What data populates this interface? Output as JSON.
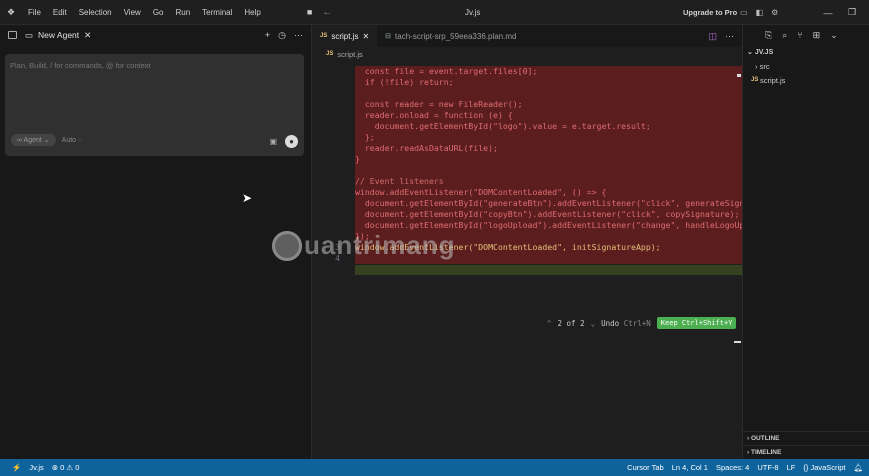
{
  "titlebar": {
    "menus": [
      "File",
      "Edit",
      "Selection",
      "View",
      "Go",
      "Run",
      "Terminal",
      "Help"
    ],
    "title": "Jv.js",
    "upgrade": "Upgrade to Pro"
  },
  "chat": {
    "tab_label": "New Agent",
    "placeholder": "Plan, Build, / for commands, @ for context",
    "agent_mode": "∞ Agent ⌄",
    "model": "Auto ◌"
  },
  "editor": {
    "tabs": [
      {
        "label": "script.js",
        "icon": "JS"
      },
      {
        "label": "tach-script-srp_59eea336.plan.md",
        "icon": "md"
      }
    ],
    "breadcrumb": "script.js",
    "lines": [
      {
        "num": "",
        "text": "  const file = event.target.files[0];",
        "kind": "removed"
      },
      {
        "num": "",
        "text": "  if (!file) return;",
        "kind": "removed"
      },
      {
        "num": "",
        "text": "",
        "kind": "removed"
      },
      {
        "num": "",
        "text": "  const reader = new FileReader();",
        "kind": "removed"
      },
      {
        "num": "",
        "text": "  reader.onload = function (e) {",
        "kind": "removed"
      },
      {
        "num": "",
        "text": "    document.getElementById(\"logo\").value = e.target.result;",
        "kind": "removed"
      },
      {
        "num": "",
        "text": "  };",
        "kind": "removed"
      },
      {
        "num": "",
        "text": "  reader.readAsDataURL(file);",
        "kind": "removed"
      },
      {
        "num": "",
        "text": "}",
        "kind": "removed"
      },
      {
        "num": "",
        "text": "",
        "kind": "removed"
      },
      {
        "num": "",
        "text": "// Event listeners",
        "kind": "removed"
      },
      {
        "num": "",
        "text": "window.addEventListener(\"DOMContentLoaded\", () => {",
        "kind": "removed"
      },
      {
        "num": "",
        "text": "  document.getElementById(\"generateBtn\").addEventListener(\"click\", generateSign",
        "kind": "removed"
      },
      {
        "num": "",
        "text": "  document.getElementById(\"copyBtn\").addEventListener(\"click\", copySignature);",
        "kind": "removed"
      },
      {
        "num": "",
        "text": "  document.getElementById(\"logoUpload\").addEventListener(\"change\", handleLogoUp",
        "kind": "removed"
      },
      {
        "num": "",
        "text": "});",
        "kind": "removed"
      },
      {
        "num": "3",
        "text": "window.addEventListener(\"DOMContentLoaded\", initSignatureApp);",
        "kind": "added"
      },
      {
        "num": "4",
        "text": "",
        "kind": "normal"
      }
    ],
    "diff_nav": "2 of 2",
    "undo_label": "Undo",
    "undo_shortcut": "Ctrl+N",
    "keep_label": "Keep",
    "keep_shortcut": "Ctrl+Shift+Y"
  },
  "explorer": {
    "root": "JV.JS",
    "folder": "src",
    "file": "script.js",
    "outline": "OUTLINE",
    "timeline": "TIMELINE"
  },
  "watermark": "uantrimang",
  "statusbar": {
    "file": "Jv.js",
    "problems": "⊗ 0 ⚠ 0",
    "cursor_tab": "Cursor Tab",
    "position": "Ln 4, Col 1",
    "spaces": "Spaces: 4",
    "encoding": "UTF-8",
    "eol": "LF",
    "language": "{} JavaScript"
  },
  "colors": {
    "statusbar_bg": "#0e639c",
    "removed_bg": "#5b1d1d",
    "added_bg": "#35411f",
    "keep_btn": "#4caf50"
  }
}
